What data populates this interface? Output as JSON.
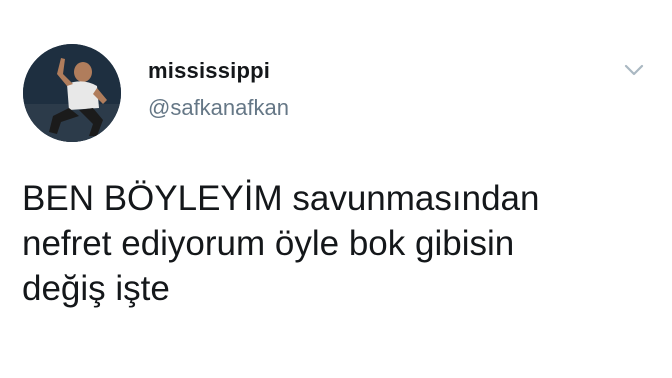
{
  "tweet": {
    "display_name": "mississippi",
    "handle": "@safkanafkan",
    "text": "BEN BÖYLEYİM savunmasından\nnefret ediyorum öyle bok gibisin\ndeğiş işte",
    "avatar_icon": "profile-photo",
    "menu_icon": "chevron-down-icon"
  },
  "colors": {
    "name": "#14171a",
    "handle": "#657786",
    "caret": "#aab8c2",
    "background": "#ffffff"
  }
}
